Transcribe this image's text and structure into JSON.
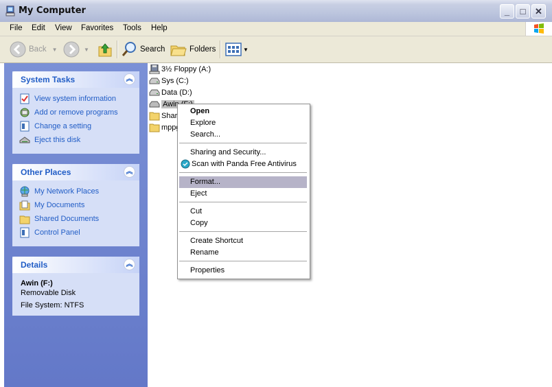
{
  "window": {
    "title": "My Computer"
  },
  "menubar": [
    "File",
    "Edit",
    "View",
    "Favorites",
    "Tools",
    "Help"
  ],
  "toolbar": {
    "back": "Back",
    "search": "Search",
    "folders": "Folders"
  },
  "system_tasks": {
    "title": "System Tasks",
    "items": [
      "View system information",
      "Add or remove programs",
      "Change a setting",
      "Eject this disk"
    ]
  },
  "other_places": {
    "title": "Other Places",
    "items": [
      "My Network Places",
      "My Documents",
      "Shared Documents",
      "Control Panel"
    ]
  },
  "details": {
    "title": "Details",
    "name": "Awin (F:)",
    "type": "Removable Disk",
    "fs": "File System: NTFS"
  },
  "files": [
    {
      "name": "3½ Floppy (A:)",
      "icon": "floppy-drive-icon"
    },
    {
      "name": "Sys (C:)",
      "icon": "hard-drive-icon"
    },
    {
      "name": "Data (D:)",
      "icon": "hard-drive-icon"
    },
    {
      "name": "Awin (F:)",
      "icon": "removable-drive-icon",
      "selected": true
    },
    {
      "name": "Share",
      "icon": "folder-icon"
    },
    {
      "name": "mppg",
      "icon": "folder-icon"
    }
  ],
  "context_menu": {
    "open": "Open",
    "explore": "Explore",
    "search": "Search...",
    "sharing": "Sharing and Security...",
    "scan": "Scan with Panda Free Antivirus",
    "format": "Format...",
    "eject": "Eject",
    "cut": "Cut",
    "copy": "Copy",
    "shortcut": "Create Shortcut",
    "rename": "Rename",
    "properties": "Properties"
  },
  "colors": {
    "link": "#215dc6",
    "taskpane": "#7b91d6",
    "highlight": "#b6b3c8"
  }
}
